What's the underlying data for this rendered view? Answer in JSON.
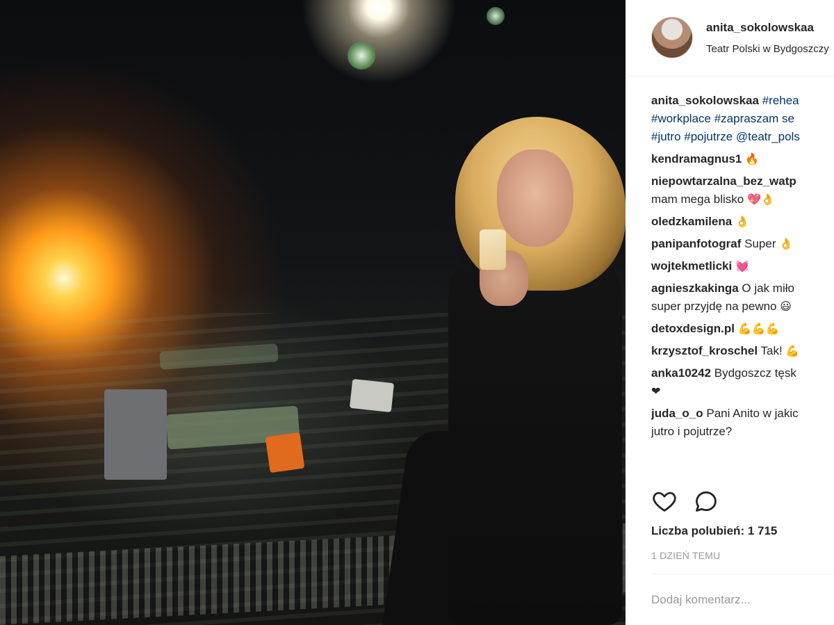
{
  "post": {
    "username": "anita_sokolowskaa",
    "location": "Teatr Polski w Bydgoszczy"
  },
  "caption": {
    "username": "anita_sokolowskaa",
    "line1": "#rehea",
    "line2": "#workplace #zapraszam se",
    "line3": "#jutro #pojutrze @teatr_pols"
  },
  "comments": [
    {
      "user": "kendramagnus1",
      "text": "",
      "emoji": "🔥"
    },
    {
      "user": "niepowtarzalna_bez_watp",
      "text": "",
      "line2": "mam mega blisko",
      "emoji": "💖👌"
    },
    {
      "user": "oledzkamilena",
      "text": "",
      "emoji": "👌"
    },
    {
      "user": "panipanfotograf",
      "text": "Super",
      "emoji": "👌"
    },
    {
      "user": "wojtekmetlicki",
      "text": "",
      "emoji": "💓"
    },
    {
      "user": "agnieszkakinga",
      "text": "O jak miło",
      "line2": "super przyjdę na pewno",
      "emoji": "😃"
    },
    {
      "user": "detoxdesign.pl",
      "text": "",
      "emoji": "💪💪💪"
    },
    {
      "user": "krzysztof_kroschel",
      "text": "Tak!",
      "emoji": "💪"
    },
    {
      "user": "anka10242",
      "text": "Bydgoszcz tęsk",
      "line2": "",
      "emoji": "❤"
    },
    {
      "user": "juda_o_o",
      "text": "Pani Anito w jakic",
      "line2": "jutro i pojutrze?"
    }
  ],
  "actions": {
    "like_icon": "heart-icon",
    "comment_icon": "comment-icon"
  },
  "likes_text": "Liczba polubień: 1 715",
  "time_ago": "1 DZIEŃ TEMU",
  "add_comment": {
    "placeholder": "Dodaj komentarz..."
  }
}
